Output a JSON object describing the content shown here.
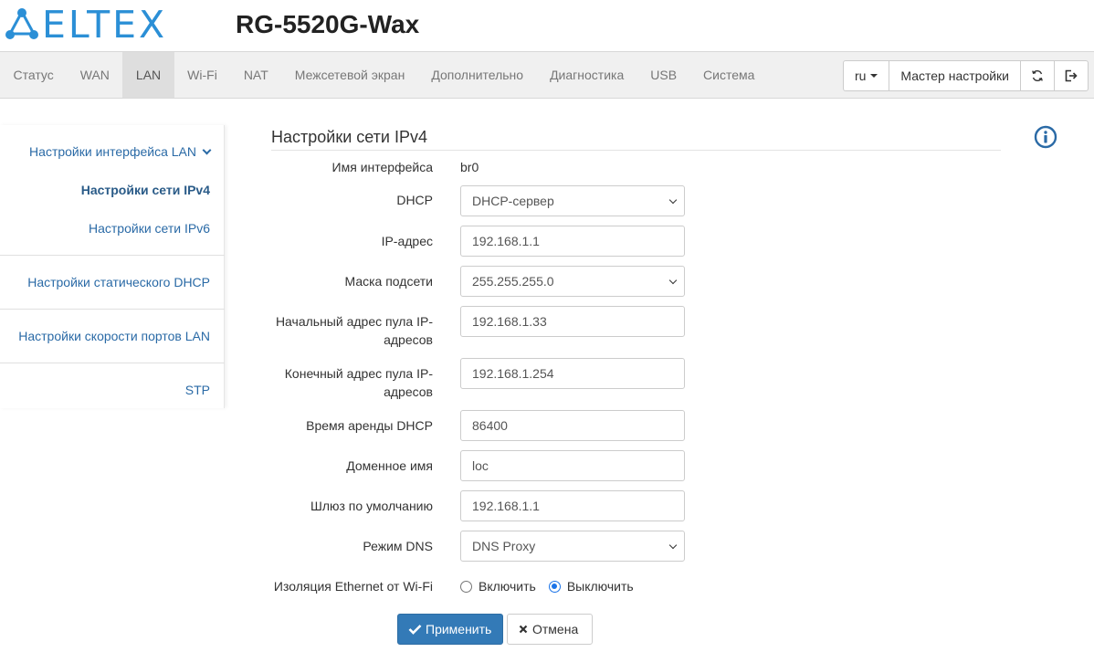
{
  "header": {
    "logo_text": "ELTEX",
    "device_title": "RG-5520G-Wax"
  },
  "nav": {
    "items": [
      {
        "label": "Статус"
      },
      {
        "label": "WAN"
      },
      {
        "label": "LAN",
        "active": true
      },
      {
        "label": "Wi-Fi"
      },
      {
        "label": "NAT"
      },
      {
        "label": "Межсетевой экран"
      },
      {
        "label": "Дополнительно"
      },
      {
        "label": "Диагностика"
      },
      {
        "label": "USB"
      },
      {
        "label": "Система"
      }
    ],
    "language": "ru",
    "wizard_label": "Мастер настройки",
    "icons": [
      "refresh-icon",
      "logout-icon"
    ]
  },
  "sidebar": {
    "items": [
      {
        "label": "Настройки интерфейса LAN",
        "expanded": true
      },
      {
        "label": "Настройки сети IPv4",
        "active": true
      },
      {
        "label": "Настройки сети IPv6"
      },
      {
        "label": "Настройки статического DHCP"
      },
      {
        "label": "Настройки скорости портов LAN"
      },
      {
        "label": "STP"
      }
    ]
  },
  "form": {
    "title": "Настройки сети IPv4",
    "interface_name": {
      "label": "Имя интерфейса",
      "value": "br0"
    },
    "dhcp": {
      "label": "DHCP",
      "value": "DHCP-сервер"
    },
    "ip_address": {
      "label": "IP-адрес",
      "value": "192.168.1.1"
    },
    "subnet_mask": {
      "label": "Маска подсети",
      "value": "255.255.255.0"
    },
    "pool_start": {
      "label_line1": "Начальный адрес пула IP-",
      "label_line2": "адресов",
      "value": "192.168.1.33"
    },
    "pool_end": {
      "label_line1": "Конечный адрес пула IP-",
      "label_line2": "адресов",
      "value": "192.168.1.254"
    },
    "lease_time": {
      "label": "Время аренды DHCP",
      "value": "86400"
    },
    "domain_name": {
      "label": "Доменное имя",
      "value": "loc"
    },
    "default_gateway": {
      "label": "Шлюз по умолчанию",
      "value": "192.168.1.1"
    },
    "dns_mode": {
      "label": "Режим DNS",
      "value": "DNS Proxy"
    },
    "isolation": {
      "label": "Изоляция Ethernet от Wi-Fi",
      "options": [
        {
          "label": "Включить",
          "checked": false
        },
        {
          "label": "Выключить",
          "checked": true
        }
      ]
    },
    "apply_label": "Применить",
    "cancel_label": "Отмена"
  },
  "colors": {
    "brand": "#2b8fd6",
    "link": "#2a6aa6",
    "primary_button": "#337ab7",
    "navbar_bg": "#f0f0f0",
    "navbar_active_bg": "#dedede"
  }
}
